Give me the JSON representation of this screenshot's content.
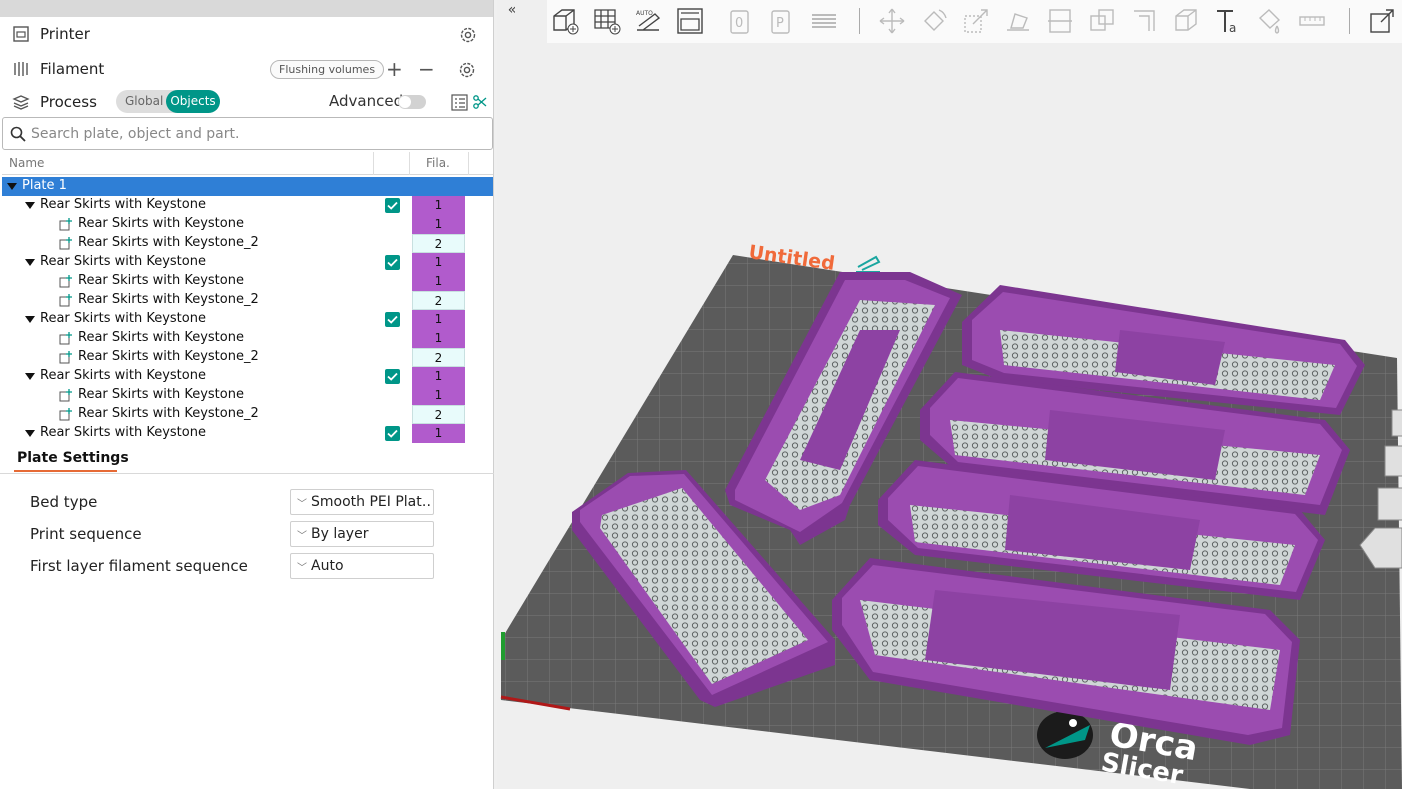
{
  "sidebar": {
    "printer": {
      "label": "Printer"
    },
    "filament": {
      "label": "Filament",
      "flushing_label": "Flushing volumes",
      "add": "+",
      "remove": "−"
    },
    "process": {
      "label": "Process",
      "global_label": "Global",
      "objects_label": "Objects",
      "advanced_label": "Advanced"
    },
    "search": {
      "placeholder": "Search plate, object and part."
    },
    "tree": {
      "col_name": "Name",
      "col_fila": "Fila.",
      "plate": "Plate 1",
      "objects": [
        {
          "name": "Rear Skirts with Keystone",
          "fila": "1",
          "parts": [
            {
              "name": "Rear Skirts with Keystone",
              "fila": "1"
            },
            {
              "name": "Rear Skirts with Keystone_2",
              "fila": "2"
            }
          ]
        },
        {
          "name": "Rear Skirts with Keystone",
          "fila": "1",
          "parts": [
            {
              "name": "Rear Skirts with Keystone",
              "fila": "1"
            },
            {
              "name": "Rear Skirts with Keystone_2",
              "fila": "2"
            }
          ]
        },
        {
          "name": "Rear Skirts with Keystone",
          "fila": "1",
          "parts": [
            {
              "name": "Rear Skirts with Keystone",
              "fila": "1"
            },
            {
              "name": "Rear Skirts with Keystone_2",
              "fila": "2"
            }
          ]
        },
        {
          "name": "Rear Skirts with Keystone",
          "fila": "1",
          "parts": [
            {
              "name": "Rear Skirts with Keystone",
              "fila": "1"
            },
            {
              "name": "Rear Skirts with Keystone_2",
              "fila": "2"
            }
          ]
        },
        {
          "name": "Rear Skirts with Keystone",
          "fila": "1",
          "parts": []
        }
      ]
    },
    "plate_settings": {
      "tab": "Plate Settings",
      "bed_type_label": "Bed type",
      "bed_type_value": "Smooth PEI Plat…",
      "print_sequence_label": "Print sequence",
      "print_sequence_value": "By layer",
      "first_layer_label": "First layer filament sequence",
      "first_layer_value": "Auto"
    }
  },
  "viewport": {
    "collapse_label": "«",
    "plate_name": "Untitled",
    "logo_top": "Orca",
    "logo_bottom": "Slicer"
  },
  "colors": {
    "accent": "#009688",
    "selection": "#2f7fd6",
    "filament_1": "#b15bcc",
    "filament_2": "#e8fbfb",
    "model": "#8e3fa0",
    "bed": "#5a5a5a",
    "plate_name": "#f06a3a"
  }
}
